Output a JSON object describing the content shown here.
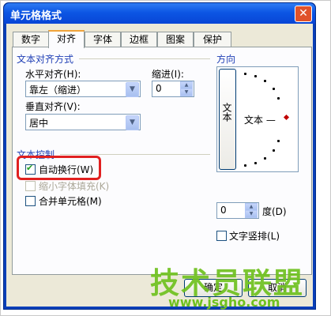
{
  "window": {
    "title": "单元格格式",
    "close": "✕"
  },
  "tabs": [
    {
      "label": "数字"
    },
    {
      "label": "对齐"
    },
    {
      "label": "字体"
    },
    {
      "label": "边框"
    },
    {
      "label": "图案"
    },
    {
      "label": "保护"
    }
  ],
  "active_tab": "对齐",
  "text_alignment": {
    "title": "文本对齐方式",
    "horizontal_label": "水平对齐(H):",
    "horizontal_value": "靠左（缩进）",
    "vertical_label": "垂直对齐(V):",
    "vertical_value": "居中",
    "indent_label": "缩进(I):",
    "indent_value": "0"
  },
  "text_control": {
    "title": "文本控制",
    "wrap_text": {
      "label": "自动换行(W)",
      "checked": true
    },
    "shrink_to_fit": {
      "label": "缩小字体填充(K)",
      "checked": false,
      "disabled": true
    },
    "merge_cells": {
      "label": "合并单元格(M)",
      "checked": false
    }
  },
  "orientation": {
    "title": "方向",
    "vertical_text": "文本",
    "horizontal_text": "文本 —",
    "degrees_value": "0",
    "degrees_label": "度(D)",
    "vertical_checkbox": {
      "label": "文字竖排(L)",
      "checked": false
    }
  },
  "buttons": {
    "ok": "确定",
    "cancel": "取消"
  },
  "watermark": {
    "brand": "技术员联盟",
    "url": "www.jsgho.com"
  },
  "colors": {
    "titlebar": "#0c56e4",
    "group_title": "#1f3fb5",
    "highlight": "#e02020",
    "watermark": "#6fc11f"
  }
}
